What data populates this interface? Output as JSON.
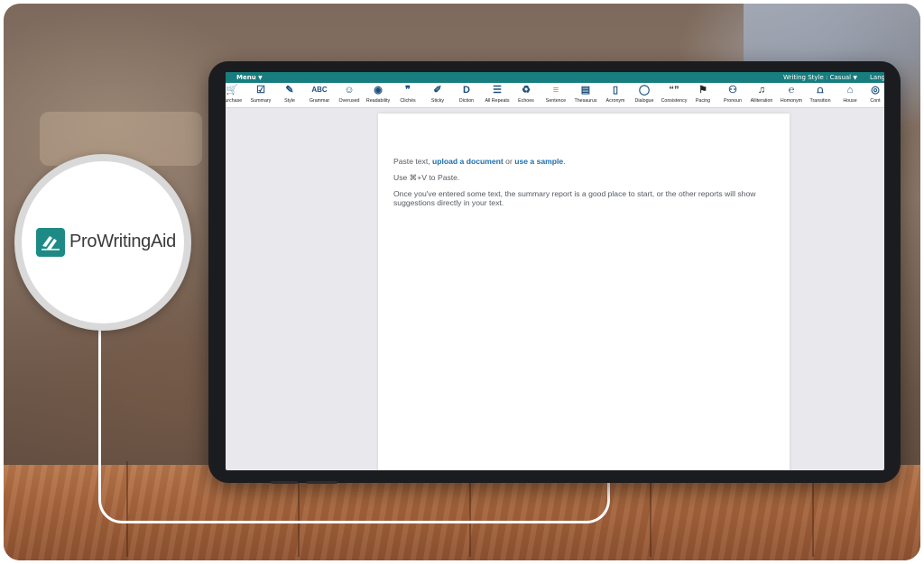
{
  "brand": {
    "name": "ProWritingAid",
    "color": "#1d8a85"
  },
  "menubar": {
    "menu_label": "Menu",
    "writing_style": "Writing Style : Casual",
    "language": "Lang",
    "color": "#177d7e"
  },
  "toolbar": {
    "items": [
      {
        "label": "Purchase",
        "icon": "cart-icon"
      },
      {
        "label": "Summary",
        "icon": "checklist-icon"
      },
      {
        "label": "Style",
        "icon": "style-pen-icon"
      },
      {
        "label": "Grammar",
        "icon": "abc-check-icon"
      },
      {
        "label": "Overused",
        "icon": "face-icon"
      },
      {
        "label": "Readability",
        "icon": "eye-icon"
      },
      {
        "label": "Clichés",
        "icon": "speech-quote-icon"
      },
      {
        "label": "Sticky",
        "icon": "pin-icon"
      },
      {
        "label": "Diction",
        "icon": "dictionary-icon"
      },
      {
        "label": "All Repeats",
        "icon": "list-icon"
      },
      {
        "label": "Echoes",
        "icon": "recycle-icon"
      },
      {
        "label": "Sentence",
        "icon": "bars-icon"
      },
      {
        "label": "Thesaurus",
        "icon": "book-icon"
      },
      {
        "label": "Acronym",
        "icon": "document-icon"
      },
      {
        "label": "Dialogue",
        "icon": "speech-bubble-icon"
      },
      {
        "label": "Consistency",
        "icon": "quotes-icon"
      },
      {
        "label": "Pacing",
        "icon": "runner-icon"
      },
      {
        "label": "Pronoun",
        "icon": "people-icon"
      },
      {
        "label": "Alliteration",
        "icon": "music-note-icon"
      },
      {
        "label": "Homonym",
        "icon": "ear-icon"
      },
      {
        "label": "Transition",
        "icon": "bridge-icon"
      },
      {
        "label": "House",
        "icon": "house-icon"
      },
      {
        "label": "Cont",
        "icon": "combo-icon"
      }
    ]
  },
  "editor": {
    "line1_prefix": "Paste text,",
    "upload_link": "upload a document",
    "line1_or": "or",
    "sample_link": "use a sample",
    "line1_suffix": ".",
    "line2": "Use ⌘+V to Paste.",
    "line3": "Once you've entered some text, the summary report is a good place to start, or the other reports will show suggestions directly in your text."
  }
}
